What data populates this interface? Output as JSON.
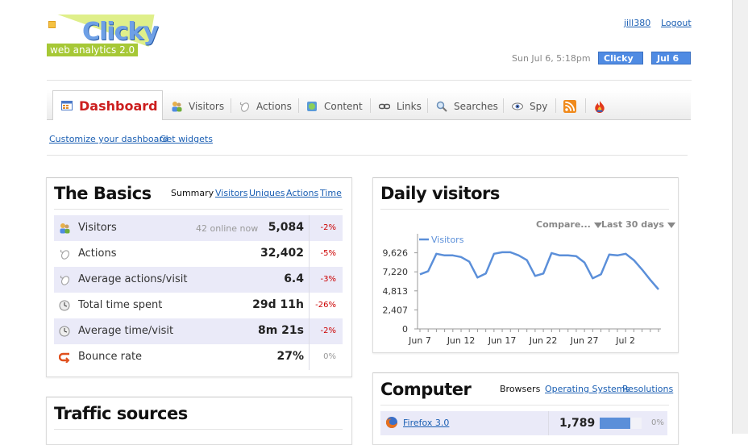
{
  "logo": {
    "wordmark": "Clicky",
    "subtitle": "web analytics 2.0"
  },
  "user": {
    "username": "jill380",
    "logout_label": "Logout"
  },
  "header": {
    "datetime": "Sun Jul 6, 5:18pm",
    "site_button": "Clicky ▼",
    "date_button": "Jul 6 ▼"
  },
  "nav": {
    "tabs": [
      {
        "label": "Dashboard",
        "icon": "dashboard-icon",
        "active": true
      },
      {
        "label": "Visitors",
        "icon": "visitors-icon"
      },
      {
        "label": "Actions",
        "icon": "actions-icon"
      },
      {
        "label": "Content",
        "icon": "content-icon"
      },
      {
        "label": "Links",
        "icon": "links-icon"
      },
      {
        "label": "Searches",
        "icon": "searches-icon"
      },
      {
        "label": "Spy",
        "icon": "spy-icon"
      },
      {
        "label": "",
        "icon": "rss-icon"
      },
      {
        "label": "",
        "icon": "flame-icon"
      }
    ]
  },
  "sub_links": {
    "customize": "Customize your dashboard",
    "widgets": "Get widgets"
  },
  "basics": {
    "title": "The Basics",
    "tabs": [
      "Summary",
      "Visitors",
      "Uniques",
      "Actions",
      "Time"
    ],
    "rows": [
      {
        "icon": "visitors-icon",
        "label": "Visitors",
        "note": "42 online now",
        "value": "5,084",
        "change": "-2%"
      },
      {
        "icon": "mouse-icon",
        "label": "Actions",
        "note": "",
        "value": "32,402",
        "change": "-5%"
      },
      {
        "icon": "mouse-icon",
        "label": "Average actions/visit",
        "note": "",
        "value": "6.4",
        "change": "-3%"
      },
      {
        "icon": "clock-icon",
        "label": "Total time spent",
        "note": "",
        "value": "29d 11h",
        "change": "-26%"
      },
      {
        "icon": "clock-icon",
        "label": "Average time/visit",
        "note": "",
        "value": "8m 21s",
        "change": "-2%"
      },
      {
        "icon": "bounce-icon",
        "label": "Bounce rate",
        "note": "",
        "value": "27%",
        "change": "0%"
      }
    ]
  },
  "traffic": {
    "title": "Traffic sources"
  },
  "daily": {
    "title": "Daily visitors",
    "compare_label": "Compare...",
    "range_label": "Last 30 days"
  },
  "chart_data": {
    "type": "line",
    "ylim": [
      0,
      12032
    ],
    "yticks": [
      "0",
      "2,407",
      "4,813",
      "7,220",
      "9,626"
    ],
    "ytick_values": [
      0,
      2407,
      4813,
      7220,
      9626
    ],
    "xtick_labels": [
      "Jun 7",
      "Jun 12",
      "Jun 17",
      "Jun 22",
      "Jun 27",
      "Jul 2"
    ],
    "xtick_index": [
      0,
      5,
      10,
      15,
      20,
      25
    ],
    "x": [
      "Jun 7",
      "Jun 8",
      "Jun 9",
      "Jun 10",
      "Jun 11",
      "Jun 12",
      "Jun 13",
      "Jun 14",
      "Jun 15",
      "Jun 16",
      "Jun 17",
      "Jun 18",
      "Jun 19",
      "Jun 20",
      "Jun 21",
      "Jun 22",
      "Jun 23",
      "Jun 24",
      "Jun 25",
      "Jun 26",
      "Jun 27",
      "Jun 28",
      "Jun 29",
      "Jun 30",
      "Jul 1",
      "Jul 2",
      "Jul 3",
      "Jul 4",
      "Jul 5",
      "Jul 6"
    ],
    "series": [
      {
        "name": "Visitors",
        "color": "#5b8fd9",
        "values": [
          6900,
          7300,
          9500,
          9300,
          9300,
          9100,
          8500,
          6500,
          7000,
          9500,
          9700,
          9700,
          9300,
          8700,
          6700,
          7000,
          9600,
          9300,
          9300,
          9200,
          8400,
          6400,
          6900,
          9400,
          9300,
          9500,
          8700,
          7500,
          6200,
          5000
        ]
      }
    ]
  },
  "computer": {
    "title": "Computer",
    "tabs": [
      "Browsers",
      "Operating Systems",
      "Resolutions"
    ],
    "rows": [
      {
        "icon": "firefox-icon",
        "label": "Firefox 3.0",
        "value": "1,789",
        "change": "0%",
        "bar_fraction": 0.35
      }
    ]
  },
  "colors": {
    "accent": "#1b5fb3",
    "dashboard_red": "#cc1f1f",
    "button_blue": "#4f8be3",
    "row_alt": "#eaeaf8",
    "line": "#5b8fd9"
  }
}
